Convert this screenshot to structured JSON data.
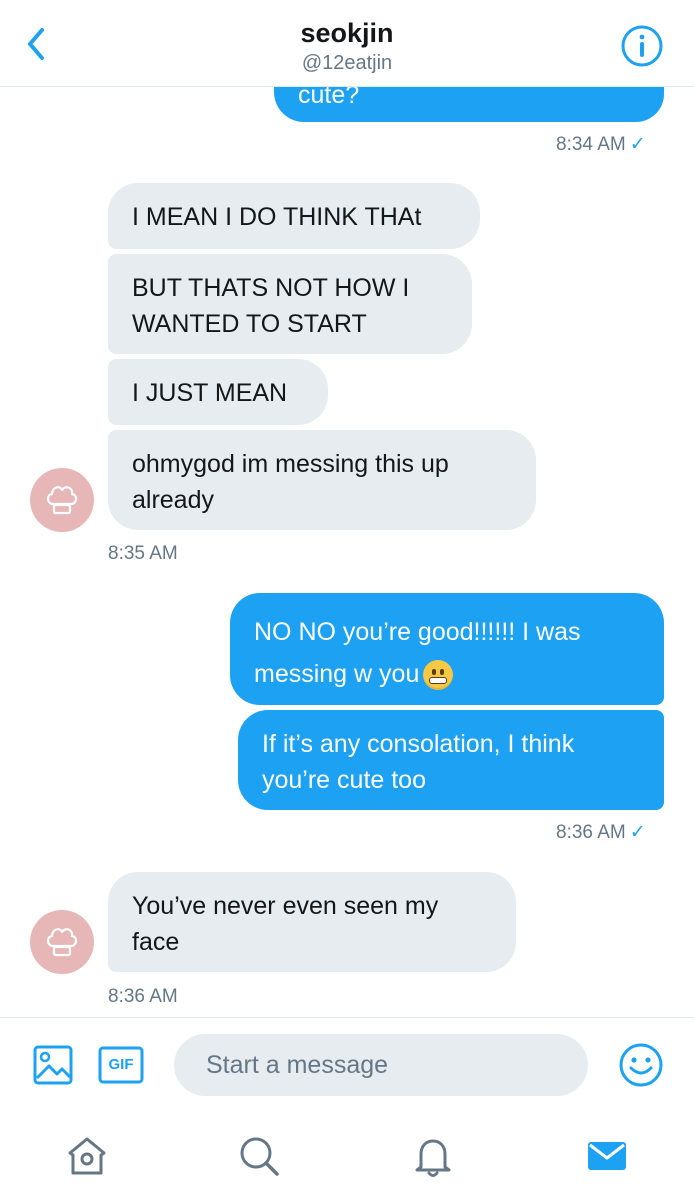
{
  "header": {
    "name": "seokjin",
    "handle": "@12eatjin"
  },
  "messages": [
    {
      "dir": "out",
      "text": "cute?"
    },
    {
      "dir": "in",
      "text": "I MEAN I DO THINK THAt"
    },
    {
      "dir": "in",
      "text": "BUT THATS NOT HOW I WANTED TO START"
    },
    {
      "dir": "in",
      "text": "I JUST MEAN"
    },
    {
      "dir": "in",
      "text": "ohmygod im messing this up already"
    },
    {
      "dir": "out",
      "text": "NO NO you’re good!!!!!! I was messing w you"
    },
    {
      "dir": "out",
      "text": "If it’s any consolation, I think you’re cute too"
    },
    {
      "dir": "in",
      "text": "You’ve never even seen my face"
    }
  ],
  "timestamps": {
    "t1": "8:34 AM",
    "t2": "8:35 AM",
    "t3": "8:36 AM",
    "t4": "8:36 AM"
  },
  "composer": {
    "placeholder": "Start a message",
    "gif_label": "GIF"
  },
  "icons": {
    "back": "chevron-left-icon",
    "info": "info-icon",
    "image": "image-icon",
    "gif": "gif-icon",
    "emoji": "emoji-icon",
    "home": "home-icon",
    "search": "search-icon",
    "notifications": "bell-icon",
    "messages": "mail-icon"
  },
  "colors": {
    "accent": "#1da1f2",
    "incoming_bubble": "#e6ecf0",
    "avatar": "#e7b6b6"
  }
}
